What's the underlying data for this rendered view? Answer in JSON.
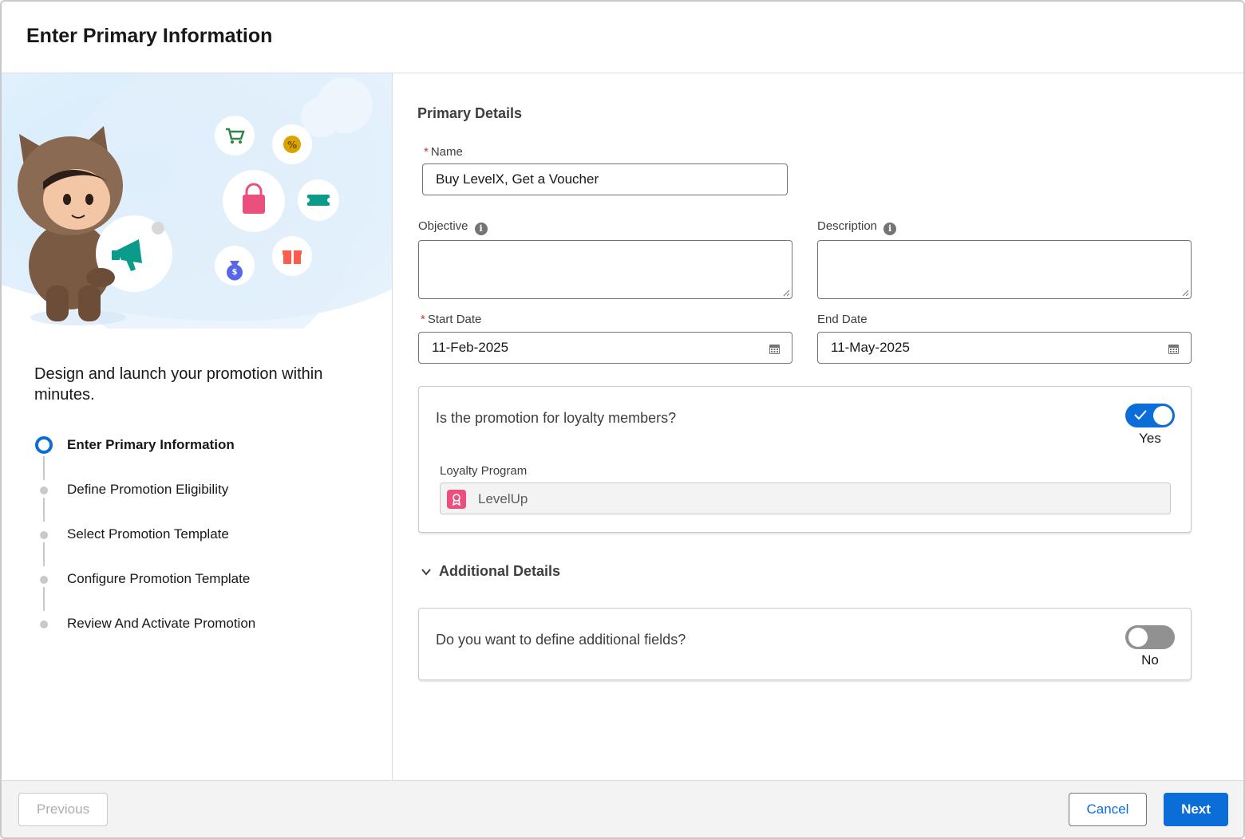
{
  "modal": {
    "title": "Enter Primary Information"
  },
  "left": {
    "tagline": "Design and launch your promotion within minutes.",
    "steps": [
      {
        "label": "Enter Primary Information",
        "state": "active"
      },
      {
        "label": "Define Promotion Eligibility",
        "state": "pending"
      },
      {
        "label": "Select Promotion Template",
        "state": "pending"
      },
      {
        "label": "Configure Promotion Template",
        "state": "pending"
      },
      {
        "label": "Review And Activate Promotion",
        "state": "pending"
      }
    ]
  },
  "primary": {
    "section_title": "Primary Details",
    "name_label": "Name",
    "name_value": "Buy LevelX, Get a Voucher",
    "objective_label": "Objective",
    "objective_value": "",
    "description_label": "Description",
    "description_value": "",
    "start_label": "Start Date",
    "start_value": "11-Feb-2025",
    "end_label": "End Date",
    "end_value": "11-May-2025",
    "required_mark": "*"
  },
  "loyalty": {
    "question": "Is the promotion for loyalty members?",
    "toggle_state": "Yes",
    "program_label": "Loyalty Program",
    "program_value": "LevelUp"
  },
  "additional": {
    "section_title": "Additional Details",
    "question": "Do you want to define additional fields?",
    "toggle_state": "No"
  },
  "footer": {
    "previous_label": "Previous",
    "cancel_label": "Cancel",
    "next_label": "Next"
  },
  "colors": {
    "brand_blue": "#0b6dd8",
    "required_red": "#c23934",
    "program_pink": "#ea4f7e"
  }
}
